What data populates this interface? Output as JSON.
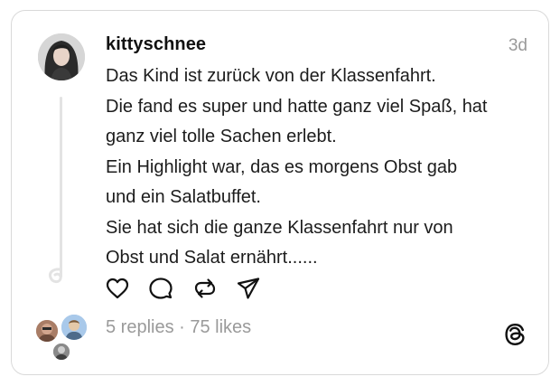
{
  "post": {
    "username": "kittyschnee",
    "timestamp": "3d",
    "lines": [
      "Das Kind ist zurück von der Klassenfahrt.",
      "Die fand es super und hatte ganz viel Spaß, hat",
      "ganz viel tolle Sachen erlebt.",
      "Ein Highlight war, das es morgens Obst gab",
      "und ein Salatbuffet.",
      "Sie hat sich die ganze Klassenfahrt nur von",
      "Obst und Salat ernährt......"
    ]
  },
  "actions": {
    "icons": [
      "heart-icon",
      "comment-icon",
      "repost-icon",
      "share-icon"
    ]
  },
  "footer": {
    "stats": "5 replies · 75 likes",
    "logo": "threads-logo"
  },
  "colors": {
    "text": "#1c1c1c",
    "muted": "#9a9a9a",
    "border": "#d9d9d9"
  }
}
